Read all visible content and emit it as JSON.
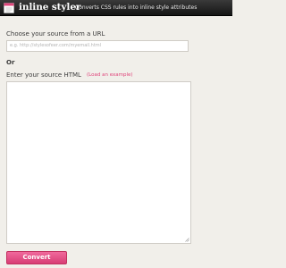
{
  "header": {
    "brand": "inline styler",
    "tagline": "Converts CSS rules into inline style attributes"
  },
  "form": {
    "url_label": "Choose your source from a URL",
    "url_placeholder": "e.g. http://stylesofeer.com/myemail.html",
    "or_label": "Or",
    "html_label": "Enter your source HTML",
    "example_link": "(Load an example)",
    "convert_label": "Convert"
  },
  "colors": {
    "accent": "#e0457b",
    "header_bg": "#1e1e1e",
    "page_bg": "#f1efea"
  },
  "icons": {
    "logo": "notepad-icon",
    "resize": "resize-grip-icon"
  }
}
